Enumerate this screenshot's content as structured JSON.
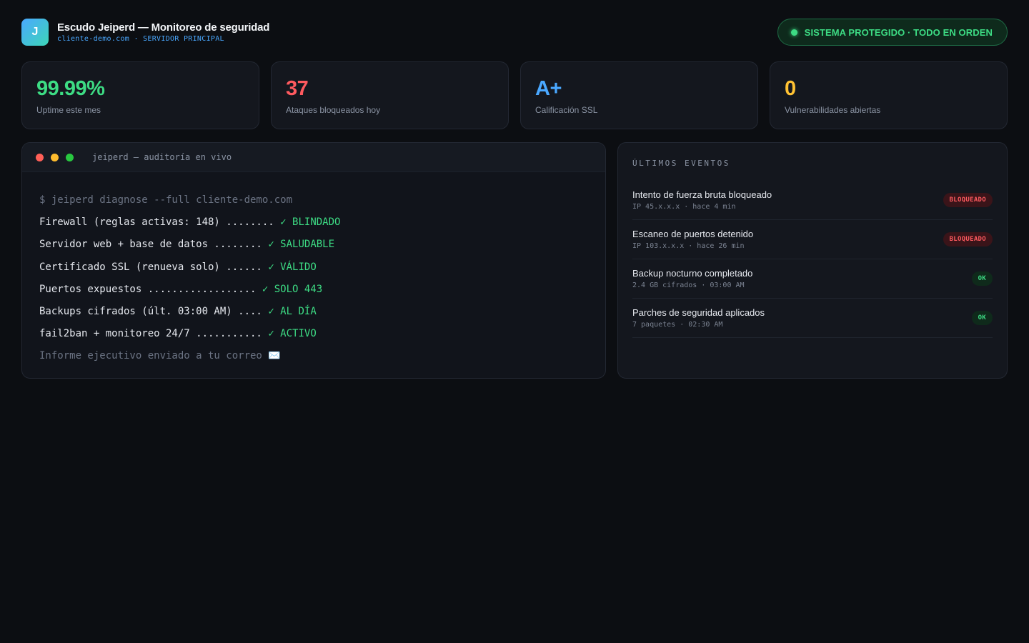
{
  "header": {
    "logo_letter": "J",
    "title": "Escudo Jeiperd — Monitoreo de seguridad",
    "subtitle": "cliente-demo.com · SERVIDOR PRINCIPAL",
    "status": "SISTEMA PROTEGIDO · TODO EN ORDEN"
  },
  "stats": [
    {
      "value": "99.99%",
      "label": "Uptime este mes",
      "color": "#3ddc84"
    },
    {
      "value": "37",
      "label": "Ataques bloqueados hoy",
      "color": "#ff5a5f"
    },
    {
      "value": "A+",
      "label": "Calificación SSL",
      "color": "#4aa8ff"
    },
    {
      "value": "0",
      "label": "Vulnerabilidades abiertas",
      "color": "#ffc233"
    }
  ],
  "terminal": {
    "title": "jeiperd — auditoría en vivo",
    "command": "$ jeiperd diagnose --full cliente-demo.com",
    "checks": [
      {
        "label": "Firewall (reglas activas: 148) ........",
        "result": "✓ BLINDADO"
      },
      {
        "label": "Servidor web + base de datos ........",
        "result": "✓ SALUDABLE"
      },
      {
        "label": "Certificado SSL (renueva solo) ......",
        "result": "✓ VÁLIDO"
      },
      {
        "label": "Puertos expuestos ..................",
        "result": "✓ SOLO 443"
      },
      {
        "label": "Backups cifrados (últ. 03:00 AM) ....",
        "result": "✓ AL DÍA"
      },
      {
        "label": "fail2ban + monitoreo 24/7 ...........",
        "result": "✓ ACTIVO"
      }
    ],
    "footer": "Informe ejecutivo enviado a tu correo",
    "footer_icon": "✉️"
  },
  "events": {
    "title": "ÚLTIMOS EVENTOS",
    "items": [
      {
        "title": "Intento de fuerza bruta bloqueado",
        "meta": "IP 45.x.x.x · hace 4 min",
        "badge": "BLOQUEADO",
        "kind": "blocked"
      },
      {
        "title": "Escaneo de puertos detenido",
        "meta": "IP 103.x.x.x · hace 26 min",
        "badge": "BLOQUEADO",
        "kind": "blocked"
      },
      {
        "title": "Backup nocturno completado",
        "meta": "2.4 GB cifrados · 03:00 AM",
        "badge": "OK",
        "kind": "ok"
      },
      {
        "title": "Parches de seguridad aplicados",
        "meta": "7 paquetes · 02:30 AM",
        "badge": "OK",
        "kind": "ok"
      }
    ]
  },
  "colors": {
    "accent_green": "#3ddc84",
    "accent_red": "#ff5a5f",
    "accent_blue": "#4aa8ff",
    "accent_yellow": "#ffc233",
    "window_dots": [
      "#ff5f57",
      "#febc2e",
      "#28c840"
    ]
  }
}
